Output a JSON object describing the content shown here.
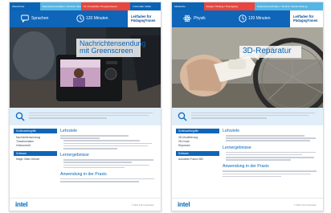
{
  "colors": {
    "intel_blue": "#0f65b8",
    "light_blue": "#54b6e6",
    "accent_red": "#e8463e",
    "summary_bg": "#dfeef9"
  },
  "cards": [
    {
      "tabs": [
        "Oberschule",
        "Naturwissenschaften / Technik / Medienbildung",
        "KI / Kreativität / Programmieren",
        "Informatik / Ethik"
      ],
      "subject": "Sprachen",
      "subject_icon": "speech-bubble-icon",
      "duration": "120 Minuten",
      "guide": "Leitfaden für Pädagog*innen",
      "title": "Nachrichtensendung mit Greenscreen",
      "summary": "",
      "sidebar_sections": [
        {
          "heading": "Schlüsselbegriffe",
          "items": [
            "Nachrichtensendung",
            "Transformation",
            "Videoschnitt"
          ]
        },
        {
          "heading": "Software",
          "items": [
            "Magix Video Deluxe"
          ]
        }
      ],
      "sections": [
        {
          "heading": "Lehrziele",
          "lines": 2,
          "bullets": 4
        },
        {
          "heading": "Lernergebnisse",
          "lines": 0,
          "bullets": 4
        },
        {
          "heading": "Anwendung in der Praxis",
          "lines": 2,
          "bullets": 0
        }
      ],
      "logo": "intel",
      "copyright": "© 2022 Intel Corporation"
    },
    {
      "tabs": [
        "Mittelstufe",
        "Design-Thinking / Prototyping",
        "Naturwissenschaften / Technik / Medienbildung"
      ],
      "subject": "Physik",
      "subject_icon": "atom-icon",
      "duration": "120 Minuten",
      "guide": "Leitfaden für Pädagog*innen",
      "title": "3D-Reparatur",
      "summary": "",
      "sidebar_sections": [
        {
          "heading": "Schlüsselbegriffe",
          "items": [
            "3D-Modellierung",
            "3D-Druck",
            "Reparatur"
          ]
        },
        {
          "heading": "Software",
          "items": [
            "Autodesk Fusion 360"
          ]
        }
      ],
      "sections": [
        {
          "heading": "Lehrziele",
          "lines": 0,
          "bullets": 3
        },
        {
          "heading": "Lernergebnisse",
          "lines": 0,
          "bullets": 4
        },
        {
          "heading": "Anwendung in der Praxis",
          "lines": 3,
          "bullets": 0
        }
      ],
      "logo": "intel",
      "copyright": "© 2022 Intel Corporation"
    }
  ]
}
